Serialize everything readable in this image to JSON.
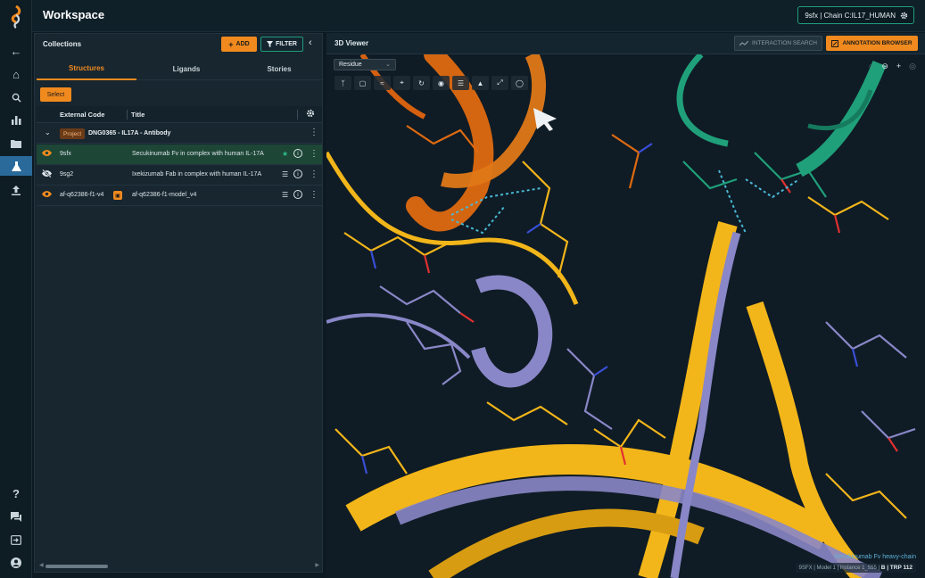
{
  "app": {
    "title": "Workspace",
    "chain_selector": "9sfx | Chain C:IL17_HUMAN"
  },
  "rail": {
    "top_icons": [
      "back-arrow-icon",
      "home-icon",
      "search-icon",
      "bar-chart-icon",
      "folder-icon",
      "flask-icon",
      "upload-icon"
    ],
    "bottom_icons": [
      "help-icon",
      "chat-icon",
      "logout-icon",
      "user-icon"
    ],
    "active": "flask-icon"
  },
  "collections": {
    "label": "Collections",
    "add_label": "ADD",
    "filter_label": "FILTER",
    "tabs": [
      {
        "label": "Structures",
        "active": true
      },
      {
        "label": "Ligands",
        "active": false
      },
      {
        "label": "Stories",
        "active": false
      }
    ],
    "select_label": "Select",
    "columns": {
      "code": "External Code",
      "title": "Title"
    },
    "group": {
      "badge": "Project",
      "name": "DNG0365 - IL17A - Antibody"
    },
    "rows": [
      {
        "code": "9sfx",
        "title": "Secukinumab Fv in complex with human IL-17A",
        "visible": true,
        "selected": true
      },
      {
        "code": "9sg2",
        "title": "Ixekizumab Fab in complex with human IL-17A",
        "visible": false,
        "selected": false
      },
      {
        "code": "af-q62386-f1-v4",
        "title": "af-q62386-f1-model_v4",
        "visible": true,
        "selected": false
      }
    ]
  },
  "viewer": {
    "label": "3D Viewer",
    "interaction_label": "INTERACTION SEARCH",
    "annotation_label": "ANNOTATION BROWSER",
    "residue_mode": "Residue",
    "hover_name": "Secukinumab Fv heavy-chain",
    "meta_prefix": "9SFX | Model 1 | Instance 1_555 |",
    "meta_residue": "B | TRP 112"
  },
  "colors": {
    "accent": "#f08a1e",
    "teal": "#1f9c7c",
    "ribbon_orange": "#e06a10",
    "ribbon_gold": "#f2b51a",
    "ribbon_lavender": "#8a87c8",
    "ribbon_green": "#1fa07a"
  }
}
